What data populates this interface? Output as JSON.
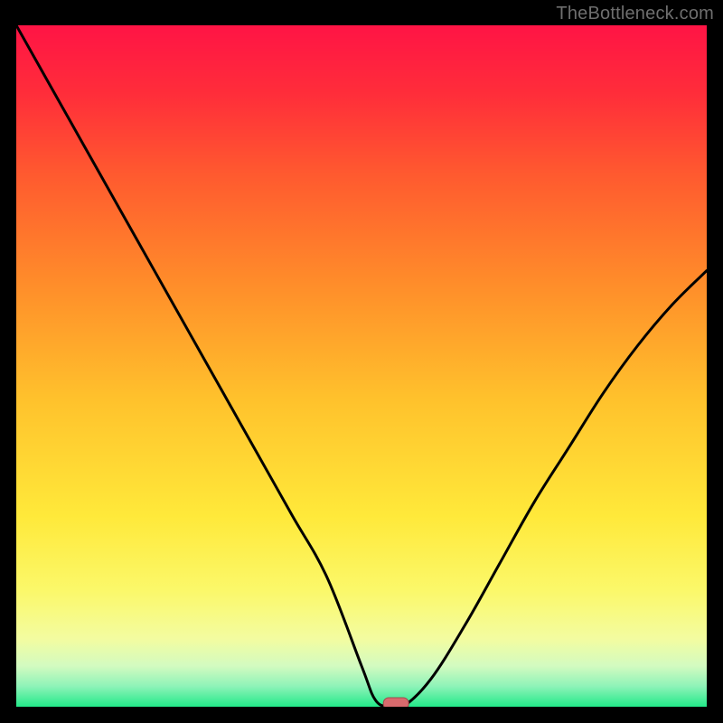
{
  "watermark": "TheBottleneck.com",
  "colors": {
    "frame": "#000000",
    "watermark": "#6e6e6e",
    "curve": "#000000",
    "marker_fill": "#d86a6d",
    "marker_stroke": "#9f4b4e",
    "gradient_stops": [
      {
        "offset": 0.0,
        "color": "#ff1445"
      },
      {
        "offset": 0.1,
        "color": "#ff2d3a"
      },
      {
        "offset": 0.22,
        "color": "#ff5a2f"
      },
      {
        "offset": 0.38,
        "color": "#ff8d2a"
      },
      {
        "offset": 0.55,
        "color": "#ffc22c"
      },
      {
        "offset": 0.72,
        "color": "#ffe93a"
      },
      {
        "offset": 0.83,
        "color": "#fbf86a"
      },
      {
        "offset": 0.9,
        "color": "#f3fca0"
      },
      {
        "offset": 0.94,
        "color": "#d3fbc0"
      },
      {
        "offset": 0.97,
        "color": "#8ef3b8"
      },
      {
        "offset": 1.0,
        "color": "#23e989"
      }
    ]
  },
  "chart_data": {
    "type": "line",
    "title": "",
    "xlabel": "",
    "ylabel": "",
    "xlim": [
      0,
      100
    ],
    "ylim": [
      0,
      100
    ],
    "grid": false,
    "legend": false,
    "x": [
      0,
      5,
      10,
      15,
      20,
      25,
      30,
      35,
      40,
      45,
      50,
      52,
      54,
      56,
      60,
      65,
      70,
      75,
      80,
      85,
      90,
      95,
      100
    ],
    "series": [
      {
        "name": "bottleneck-curve",
        "values": [
          100,
          91,
          82,
          73,
          64,
          55,
          46,
          37,
          28,
          19,
          6,
          1,
          0,
          0,
          4,
          12,
          21,
          30,
          38,
          46,
          53,
          59,
          64
        ]
      }
    ],
    "annotations": [
      {
        "type": "marker",
        "shape": "rounded-bar",
        "x": 55,
        "y": 0
      }
    ]
  }
}
